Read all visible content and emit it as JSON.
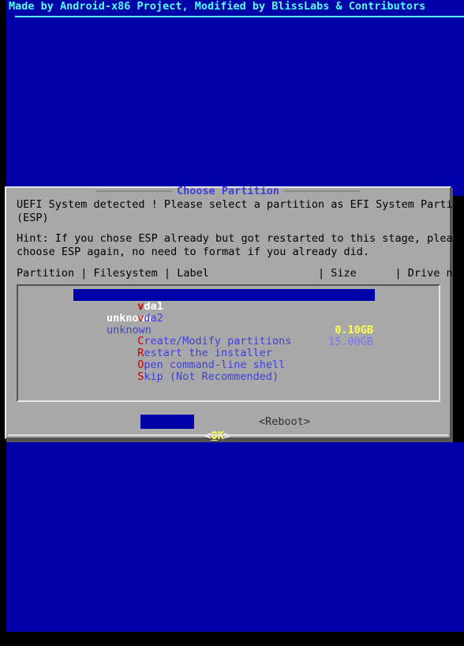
{
  "screen": {
    "header": "Made by Android-x86 Project, Modified by BlissLabs & Contributors",
    "colors": {
      "background_blue": "#0000a8",
      "header_cyan": "#55ffff",
      "dialog_gray": "#a8a8a8",
      "hotkey_red": "#c00000",
      "item_blue": "#4040d8",
      "highlight_blue": "#0000a8",
      "highlight_yellow": "#ffff54",
      "black": "#000000"
    }
  },
  "dialog": {
    "title": "Choose Partition",
    "message": "UEFI System detected ! Please select a partition as EFI System Partition\n(ESP)",
    "hint": "Hint: If you chose ESP already but got restarted to this stage, please\nchoose ESP again, no need to format if you already did.",
    "column_header": "Partition | Filesystem | Label                 | Size      | Drive name/model",
    "partitions": [
      {
        "hotkey": "v",
        "name_rest": "da1",
        "filesystem": "unknown",
        "label": "",
        "size": "0.10GB",
        "drive": "",
        "selected": true
      },
      {
        "hotkey": "v",
        "name_rest": "da2",
        "filesystem": "unknown",
        "label": "",
        "size": "15.00GB",
        "drive": "",
        "selected": false
      }
    ],
    "menu_items": [
      {
        "hotkey": "C",
        "rest": "reate/Modify partitions"
      },
      {
        "hotkey": "R",
        "rest": "estart the installer"
      },
      {
        "hotkey": "O",
        "rest": "pen command-line shell"
      },
      {
        "hotkey": "S",
        "rest": "kip (Not Recommended)"
      }
    ],
    "buttons": {
      "ok": {
        "left_arrow": "<",
        "label_underlined": "O",
        "label_rest": "K",
        "right_arrow": ">",
        "focused": true
      },
      "reboot": {
        "text": "<Reboot>",
        "focused": false
      }
    }
  }
}
